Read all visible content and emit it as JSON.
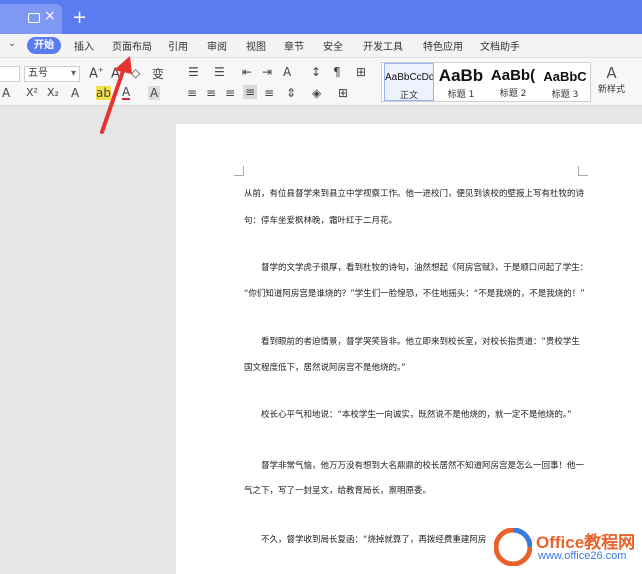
{
  "titlebar": {
    "new_tab": "+"
  },
  "menu": {
    "items": [
      "开始",
      "插入",
      "页面布局",
      "引用",
      "审阅",
      "视图",
      "章节",
      "安全",
      "开发工具",
      "特色应用",
      "文档助手"
    ]
  },
  "ribbon": {
    "font_size": "五号",
    "styles": [
      {
        "preview": "AaBbCcDd",
        "label": "正文"
      },
      {
        "preview": "AaBb",
        "label": "标题 1"
      },
      {
        "preview": "AaBb(",
        "label": "标题 2"
      },
      {
        "preview": "AaBbC",
        "label": "标题 3"
      }
    ],
    "new_style": "新样式"
  },
  "document": {
    "paragraphs": [
      [
        "从前，有位县督学来到县立中学视察工作。他一进校门，便见到该校的壁报上写有杜牧的诗",
        "句：停车坐爱枫林晚，霜叶红于二月花。"
      ],
      [
        "督学的文学虎子很厚，看到杜牧的诗句，油然想起《阿房宫赋》，于是顺口问起了学生：",
        "“你们知道阿房宫是谁烧的？”学生们一脸惶恐，不住地摇头：“不是我烧的，不是我烧的！”"
      ],
      [
        "看到眼前的者迫情景，督学哭笑皆非。他立即来到校长室，对校长指责道：“贵校学生",
        "国文程度低下，居然说阿房宫不是他烧的。”"
      ],
      [
        "校长心平气和地说：“本校学生一向诚实，既然说不是他烧的，就一定不是他烧的。”"
      ],
      [
        "督学非常气恼，他万万没有想到大名鼎鼎的校长居然不知道阿房宫是怎么一回事！他一",
        "气之下，写了一封呈文，给教育局长，禀明原委。"
      ],
      [
        "不久，督学收到局长复函：“烧掉就算了，再拨经费重建阿房"
      ]
    ]
  },
  "watermark": {
    "line1": "Office教程网",
    "line2": "www.office26.com"
  }
}
